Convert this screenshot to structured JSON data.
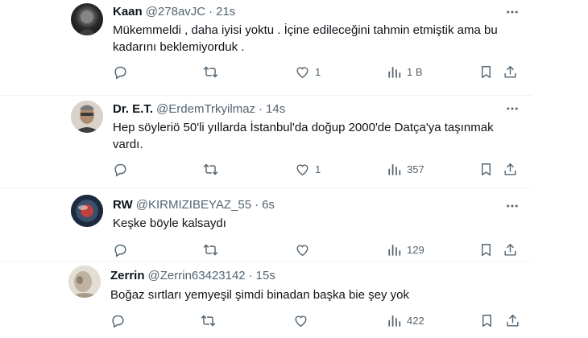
{
  "tweets": [
    {
      "name": "Kaan",
      "handle": "@278avJC",
      "sep": "·",
      "time": "21s",
      "text": "Mükemmeldi , daha iyisi yoktu . İçine edileceğini tahmin etmiştik ama bu kadarını beklemiyorduk .",
      "replies": "",
      "retweets": "",
      "likes": "1",
      "views": "1 B"
    },
    {
      "name": "Dr. E.T.",
      "handle": "@ErdemTrkyilmaz",
      "sep": "·",
      "time": "14s",
      "text": "Hep söyleriö 50'li yıllarda İstanbul'da doğup 2000'de Datça'ya taşınmak vardı.",
      "replies": "",
      "retweets": "",
      "likes": "1",
      "views": "357"
    },
    {
      "name": "RW",
      "handle": "@KIRMIZIBEYAZ_55",
      "sep": "·",
      "time": "6s",
      "text": "Keşke böyle kalsaydı",
      "replies": "",
      "retweets": "",
      "likes": "",
      "views": "129"
    },
    {
      "name": "Zerrin",
      "handle": "@Zerrin63423142",
      "sep": "·",
      "time": "15s",
      "text": "Boğaz sırtları yemyeşil şimdi binadan başka bie şey yok",
      "replies": "",
      "retweets": "",
      "likes": "",
      "views": "422"
    }
  ],
  "icons": {
    "reply": "reply-icon",
    "retweet": "retweet-icon",
    "like": "like-icon",
    "views": "views-icon",
    "bookmark": "bookmark-icon",
    "share": "share-icon",
    "more": "more-icon"
  },
  "colors": {
    "text": "#0f1419",
    "secondary": "#536471",
    "divider": "#eff3f4"
  }
}
